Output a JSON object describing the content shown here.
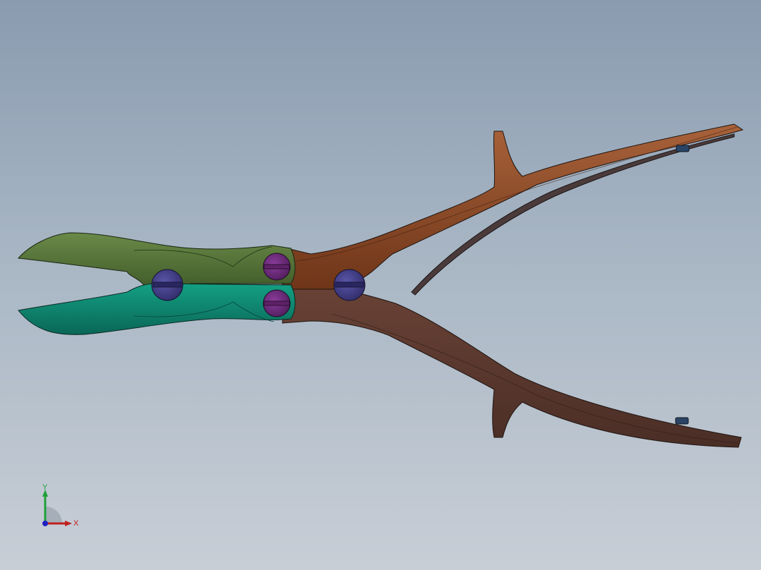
{
  "viewport": {
    "background_top": "#8a9bb0",
    "background_bottom": "#c8ced6"
  },
  "model": {
    "upper_jaw_color": "#4e6a36",
    "lower_jaw_color": "#0f8a72",
    "upper_handle_color": "#8c4a24",
    "lower_handle_color": "#5e3a30",
    "pivot_pin_color": "#3e3a7e",
    "link_pin_color": "#6a2a7a",
    "spring_color": "#4a3a3a",
    "fastener_color": "#2a4466"
  },
  "triad": {
    "y_label": "Y",
    "x_label": "X",
    "y_color": "#1fa03a",
    "x_color": "#c02020",
    "z_color": "#2020c0"
  }
}
